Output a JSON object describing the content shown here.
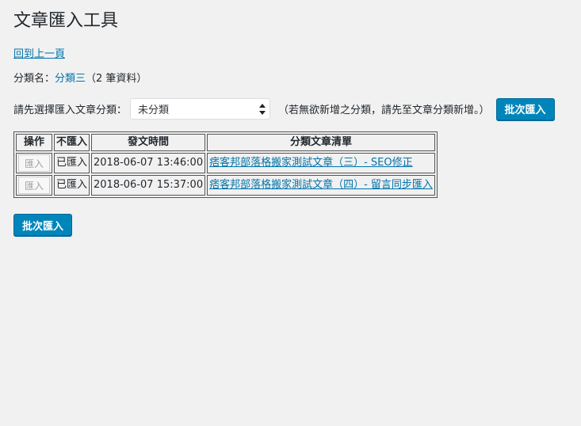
{
  "page": {
    "title": "文章匯入工具",
    "back_link": "回到上一頁"
  },
  "category": {
    "label": "分類名：",
    "name": "分類三",
    "count_text": "（2 筆資料）"
  },
  "selector": {
    "label": "請先選擇匯入文章分類：",
    "selected": "未分類",
    "hint": "（若無欲新增之分類，請先至文章分類新增。）",
    "batch_button": "批次匯入"
  },
  "table": {
    "headers": {
      "action": "操作",
      "skip": "不匯入",
      "date": "發文時間",
      "list": "分類文章清單"
    },
    "rows": [
      {
        "action": "匯入",
        "skip": "已匯入",
        "date": "2018-06-07 13:46:00",
        "title": "痞客邦部落格搬家測試文章（三）- SEO修正"
      },
      {
        "action": "匯入",
        "skip": "已匯入",
        "date": "2018-06-07 15:37:00",
        "title": "痞客邦部落格搬家測試文章（四）- 留言同步匯入"
      }
    ]
  },
  "footer": {
    "batch_button": "批次匯入"
  },
  "colors": {
    "primary": "#0085ba",
    "link": "#0073aa",
    "background": "#f1f1f1"
  }
}
